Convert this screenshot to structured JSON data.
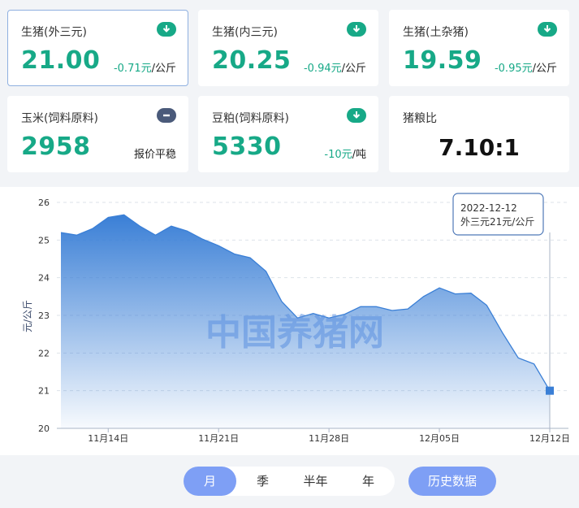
{
  "cards": [
    {
      "name": "生猪(外三元)",
      "value": "21.00",
      "change": "-0.71元",
      "unit": "/公斤",
      "icon": "arrow-down-icon"
    },
    {
      "name": "生猪(内三元)",
      "value": "20.25",
      "change": "-0.94元",
      "unit": "/公斤",
      "icon": "arrow-down-icon"
    },
    {
      "name": "生猪(土杂猪)",
      "value": "19.59",
      "change": "-0.95元",
      "unit": "/公斤",
      "icon": "arrow-down-icon"
    },
    {
      "name": "玉米(饲料原料)",
      "value": "2958",
      "status": "报价平稳",
      "icon": "minus-icon"
    },
    {
      "name": "豆粕(饲料原料)",
      "value": "5330",
      "change": "-10元",
      "unit": "/吨",
      "icon": "arrow-down-icon"
    },
    {
      "name": "猪粮比",
      "value": "7.10:1"
    }
  ],
  "colors": {
    "down": "#17a987",
    "accent": "#7e9ff5",
    "line": "#3a7fd6"
  },
  "chart_data": {
    "type": "area",
    "ylabel": "元/公斤",
    "ylim": [
      20,
      26
    ],
    "yticks": [
      20,
      21,
      22,
      23,
      24,
      25,
      26
    ],
    "x": [
      "11月11日",
      "11月12日",
      "11月13日",
      "11月14日",
      "11月15日",
      "11月16日",
      "11月17日",
      "11月18日",
      "11月19日",
      "11月20日",
      "11月21日",
      "11月22日",
      "11月23日",
      "11月24日",
      "11月25日",
      "11月26日",
      "11月27日",
      "11月28日",
      "11月29日",
      "11月30日",
      "12月01日",
      "12月02日",
      "12月03日",
      "12月04日",
      "12月05日",
      "12月06日",
      "12月07日",
      "12月08日",
      "12月09日",
      "12月10日",
      "12月11日",
      "12月12日"
    ],
    "xticks": [
      "11月14日",
      "11月21日",
      "11月28日",
      "12月05日",
      "12月12日"
    ],
    "values": [
      25.2,
      25.13,
      25.3,
      25.6,
      25.67,
      25.37,
      25.13,
      25.37,
      25.24,
      25.02,
      24.85,
      24.63,
      24.53,
      24.17,
      23.37,
      22.93,
      23.05,
      22.93,
      23.03,
      23.23,
      23.23,
      23.13,
      23.17,
      23.5,
      23.73,
      23.57,
      23.59,
      23.27,
      22.54,
      21.87,
      21.71,
      21.0
    ],
    "tooltip": {
      "date": "2022-12-12",
      "text": "外三元21元/公斤"
    },
    "watermark": "中国养猪网"
  },
  "periods": [
    "月",
    "季",
    "半年",
    "年"
  ],
  "selected_period": "月",
  "history_label": "历史数据"
}
